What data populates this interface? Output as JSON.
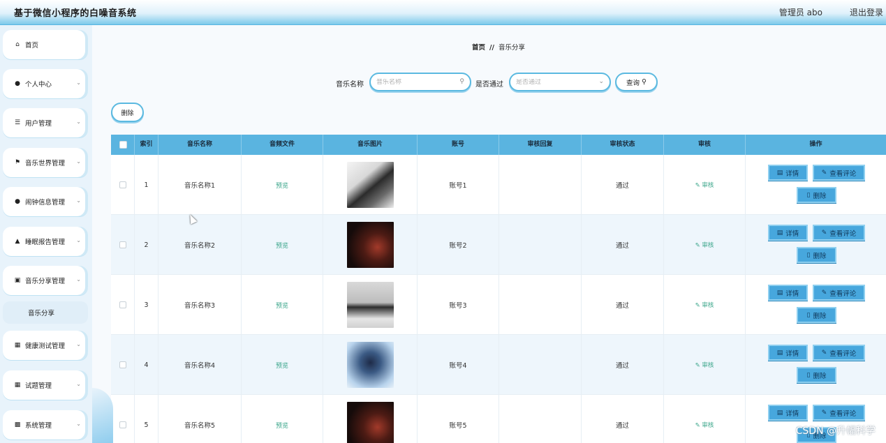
{
  "header": {
    "title": "基于微信小程序的白噪音系统",
    "user": "管理员 abo",
    "logout": "退出登录"
  },
  "sidebar": {
    "items": [
      {
        "label": "首页",
        "icon": "home-icon",
        "expandable": false
      },
      {
        "label": "个人中心",
        "icon": "user-icon",
        "expandable": true
      },
      {
        "label": "用户管理",
        "icon": "list-icon",
        "expandable": true
      },
      {
        "label": "音乐世界管理",
        "icon": "flag-icon",
        "expandable": true
      },
      {
        "label": "闹钟信息管理",
        "icon": "user-icon",
        "expandable": true
      },
      {
        "label": "睡眠报告管理",
        "icon": "thumb-icon",
        "expandable": true
      },
      {
        "label": "音乐分享管理",
        "icon": "briefcase-icon",
        "expandable": true
      },
      {
        "label": "健康测试管理",
        "icon": "grid-icon",
        "expandable": true
      },
      {
        "label": "试题管理",
        "icon": "grid-icon",
        "expandable": true
      },
      {
        "label": "系统管理",
        "icon": "monitor-icon",
        "expandable": true
      }
    ],
    "active_sub": "音乐分享"
  },
  "breadcrumb": {
    "home": "首页",
    "separator": "//",
    "current": "音乐分享"
  },
  "search": {
    "name_label": "音乐名称",
    "name_placeholder": "音乐名称",
    "pass_label": "是否通过",
    "pass_placeholder": "是否通过",
    "query_label": "查询"
  },
  "toolbar": {
    "delete_label": "删除"
  },
  "table": {
    "columns": [
      "索引",
      "音乐名称",
      "音频文件",
      "音乐图片",
      "账号",
      "审核回复",
      "审核状态",
      "审核",
      "操作"
    ],
    "rows": [
      {
        "index": "1",
        "name": "音乐名称1",
        "file": "预览",
        "account": "账号1",
        "reply": "",
        "status": "通过",
        "audit": "审核"
      },
      {
        "index": "2",
        "name": "音乐名称2",
        "file": "预览",
        "account": "账号2",
        "reply": "",
        "status": "通过",
        "audit": "审核"
      },
      {
        "index": "3",
        "name": "音乐名称3",
        "file": "预览",
        "account": "账号3",
        "reply": "",
        "status": "通过",
        "audit": "审核"
      },
      {
        "index": "4",
        "name": "音乐名称4",
        "file": "预览",
        "account": "账号4",
        "reply": "",
        "status": "通过",
        "audit": "审核"
      },
      {
        "index": "5",
        "name": "音乐名称5",
        "file": "预览",
        "account": "账号5",
        "reply": "",
        "status": "通过",
        "audit": "审核"
      }
    ],
    "actions": {
      "detail": "详情",
      "comments": "查看评论",
      "delete": "删除"
    }
  },
  "watermark": "CSDN @升幅科学",
  "colors": {
    "accent": "#5ab4e0",
    "button": "#47a7dd",
    "link_green": "#3aa58a"
  }
}
